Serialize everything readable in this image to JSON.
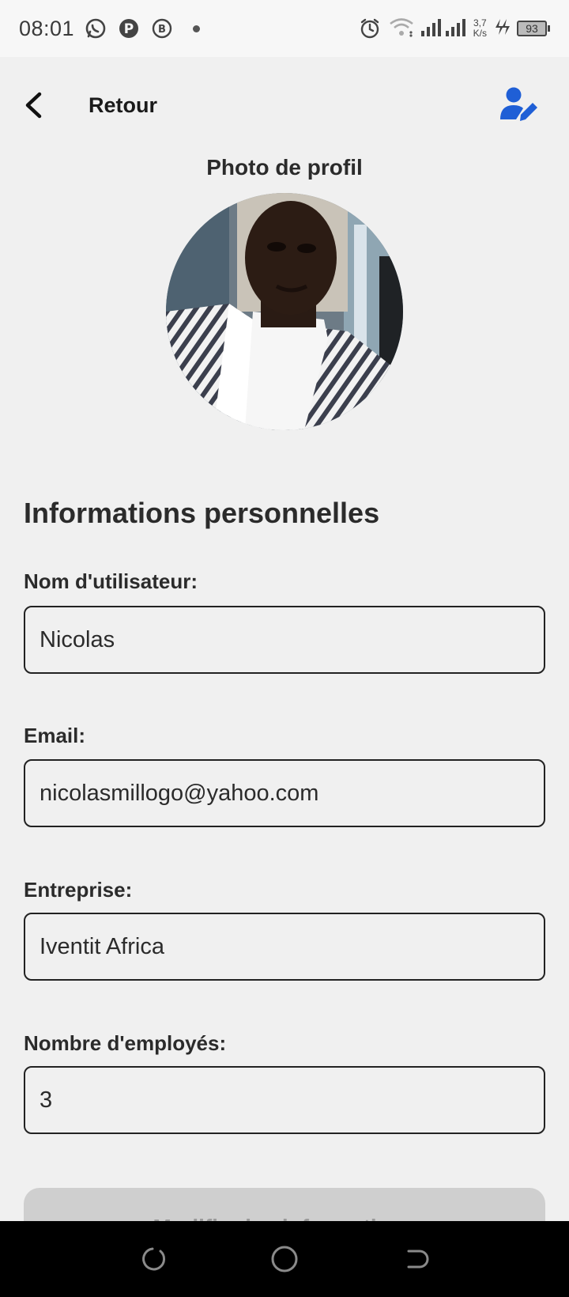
{
  "status_bar": {
    "time": "08:01",
    "net_speed_value": "3,7",
    "net_speed_unit": "K/s",
    "battery": "93"
  },
  "header": {
    "back_label": "Retour"
  },
  "profile": {
    "photo_label": "Photo de profil"
  },
  "personal_info": {
    "section_title": "Informations personnelles",
    "fields": [
      {
        "label": "Nom d'utilisateur:",
        "value": "Nicolas"
      },
      {
        "label": "Email:",
        "value": "nicolasmillogo@yahoo.com"
      },
      {
        "label": "Entreprise:",
        "value": "Iventit Africa"
      },
      {
        "label": "Nombre d'employés:",
        "value": "3"
      }
    ]
  },
  "save_button": {
    "label": "Modifier les informations"
  },
  "colors": {
    "accent": "#1f5fd6",
    "background": "#f0f0f0",
    "button_disabled": "#cfcfcf"
  },
  "icons": {
    "back": "chevron-left-icon",
    "edit_profile": "user-edit-icon",
    "whatsapp": "whatsapp-icon",
    "pinterest": "pinterest-icon",
    "business": "business-b-icon",
    "alarm": "alarm-icon",
    "wifi": "wifi-icon",
    "signal": "signal-icon",
    "charging": "charging-icon",
    "nav_recent": "recent-apps-icon",
    "nav_home": "home-icon",
    "nav_back": "nav-back-icon"
  }
}
